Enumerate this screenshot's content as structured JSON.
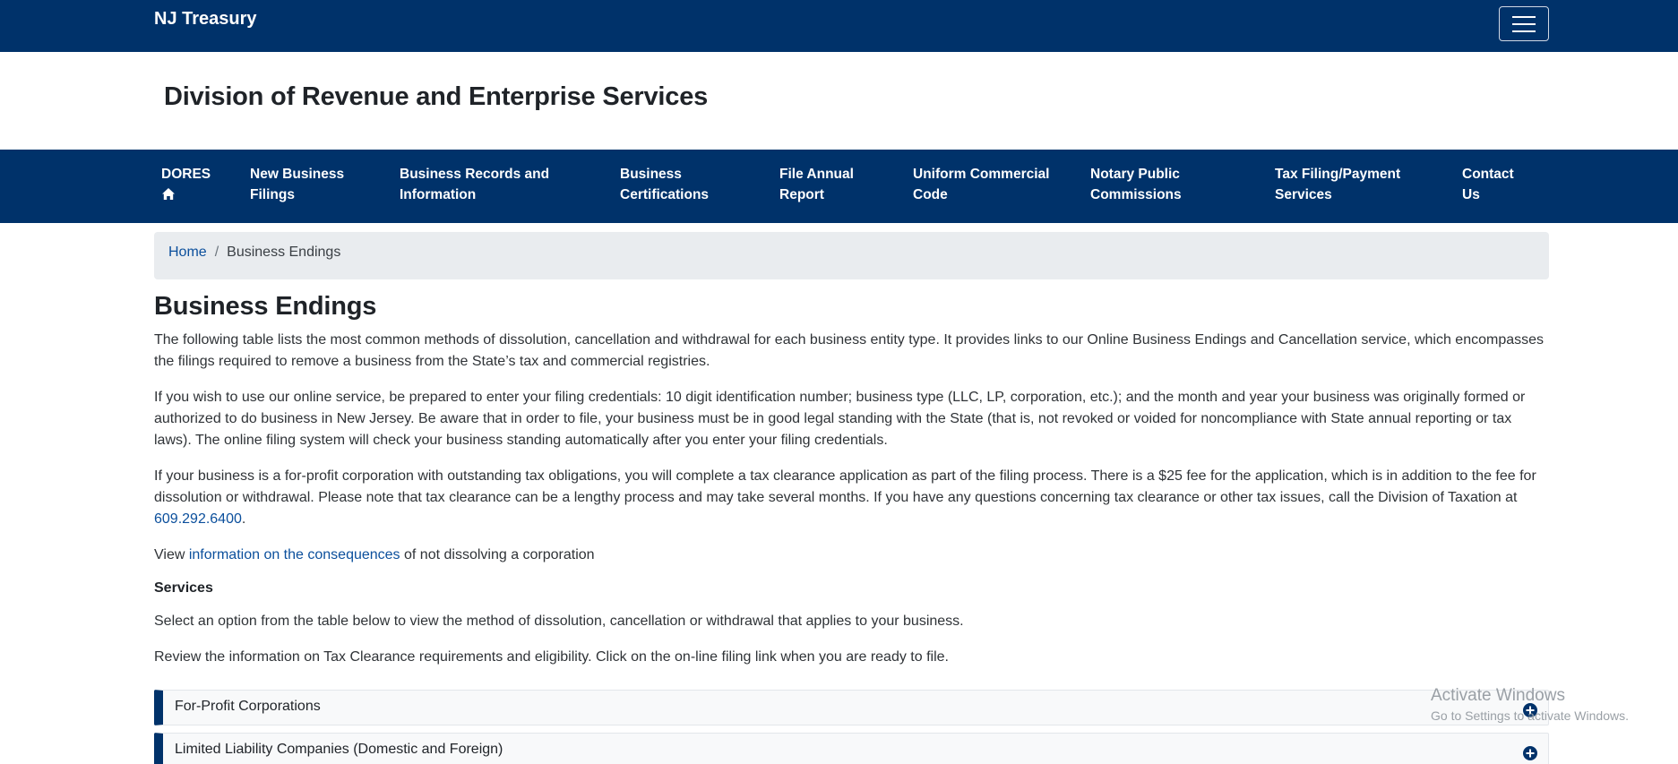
{
  "topbar": {
    "brand": "NJ Treasury"
  },
  "banner": {
    "title": "Division of Revenue and Enterprise Services"
  },
  "nav": {
    "items": [
      {
        "line1": "DORES",
        "line2": "",
        "icon": "home-icon"
      },
      {
        "line1": "New Business",
        "line2": "Filings"
      },
      {
        "line1": "Business Records and",
        "line2": "Information"
      },
      {
        "line1": "Business",
        "line2": "Certifications"
      },
      {
        "line1": "File Annual",
        "line2": "Report"
      },
      {
        "line1": "Uniform Commercial",
        "line2": "Code"
      },
      {
        "line1": "Notary Public",
        "line2": "Commissions"
      },
      {
        "line1": "Tax Filing/Payment",
        "line2": "Services"
      },
      {
        "line1": "Contact",
        "line2": "Us"
      }
    ]
  },
  "breadcrumb": {
    "home": "Home",
    "separator": "/",
    "current": "Business Endings"
  },
  "main": {
    "title": "Business Endings",
    "para1": "The following table lists the most common methods of dissolution, cancellation and withdrawal for each business entity type. It provides links to our Online Business Endings and Cancellation service, which encompasses the filings required to remove a business from the State’s tax and commercial registries.",
    "para2": "If you wish to use our online service, be prepared to enter your filing credentials: 10 digit identification number; business type (LLC, LP, corporation, etc.); and the month and year your business was originally formed or authorized to do business in New Jersey. Be aware that in order to file, your business must be in good legal standing with the State (that is, not revoked or voided for noncompliance with State annual reporting or tax laws). The online filing system will check your business standing automatically after you enter your filing credentials.",
    "para3_text": "If your business is a for-profit corporation with outstanding tax obligations, you will complete a tax clearance application as part of the filing process. There is a $25 fee for the application, which is in addition to the fee for dissolution or withdrawal. Please note that tax clearance can be a lengthy process and may take several months. If you have any questions concerning tax clearance or other tax issues, call the Division of Taxation at",
    "para3_phone": "609.292.6400",
    "para3_end": ".",
    "view_prefix": "View ",
    "view_link": "information on the consequences",
    "view_suffix": " of not dissolving a corporation",
    "services_heading": "Services",
    "select_text": "Select an option from the table below to view the method of dissolution, cancellation or withdrawal that applies to your business.",
    "review_text": "Review the information on Tax Clearance requirements and eligibility. Click on the on-line filing link when you are ready to file."
  },
  "accordion": [
    {
      "label": "For-Profit Corporations",
      "icon": "plus-circle-icon"
    },
    {
      "label": "Limited Liability Companies (Domestic and Foreign)",
      "icon": "plus-circle-icon"
    }
  ],
  "watermark": {
    "title": "Activate Windows",
    "subtitle": "Go to Settings to activate Windows."
  },
  "colors": {
    "navy": "#00326a",
    "link": "#0b4f9c",
    "breadcrumb_bg": "#e9ecef"
  }
}
